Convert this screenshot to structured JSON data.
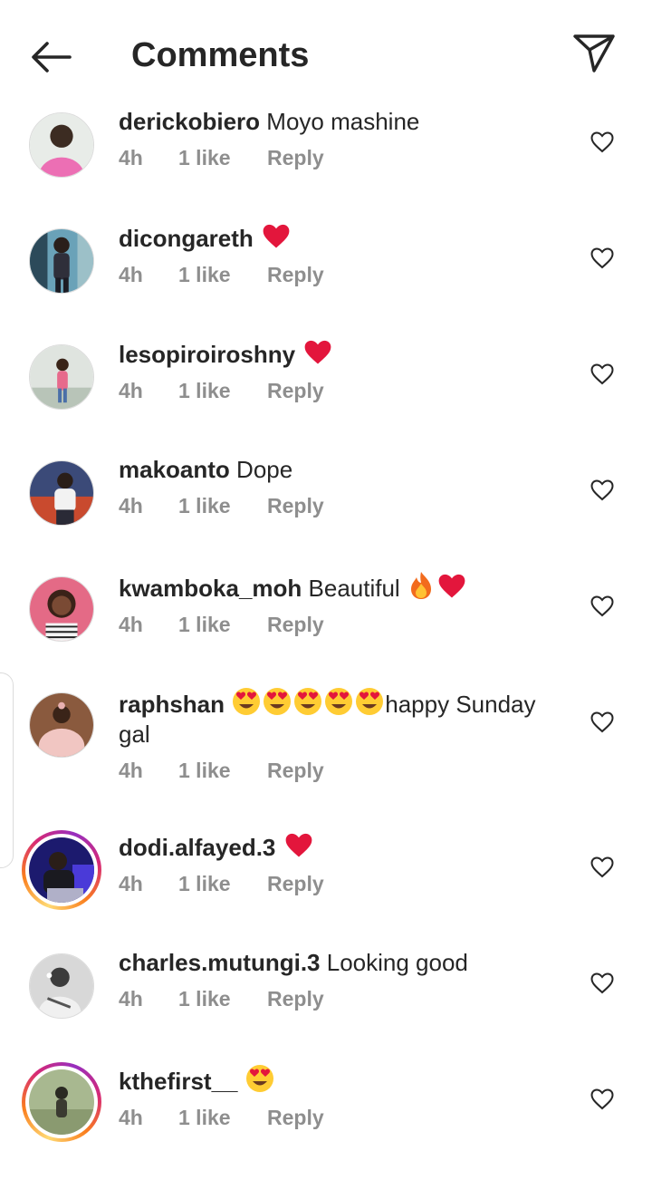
{
  "header": {
    "title": "Comments"
  },
  "comments": [
    {
      "username": "derickobiero",
      "text": "Moyo mashine",
      "emoji": [],
      "time": "4h",
      "likes": "1 like",
      "reply": "Reply"
    },
    {
      "username": "dicongareth",
      "text": "",
      "emoji": [
        "red-heart"
      ],
      "time": "4h",
      "likes": "1 like",
      "reply": "Reply"
    },
    {
      "username": "lesopiroiroshny",
      "text": "",
      "emoji": [
        "red-heart"
      ],
      "time": "4h",
      "likes": "1 like",
      "reply": "Reply"
    },
    {
      "username": "makoanto",
      "text": "Dope",
      "emoji": [],
      "time": "4h",
      "likes": "1 like",
      "reply": "Reply"
    },
    {
      "username": "kwamboka_moh",
      "text": "Beautiful",
      "emoji": [
        "fire",
        "red-heart"
      ],
      "time": "4h",
      "likes": "1 like",
      "reply": "Reply"
    },
    {
      "username": "raphshan",
      "text": "happy Sunday gal",
      "emoji": [
        "heart-eyes",
        "heart-eyes",
        "heart-eyes",
        "heart-eyes",
        "heart-eyes"
      ],
      "time": "4h",
      "likes": "1 like",
      "reply": "Reply"
    },
    {
      "username": "dodi.alfayed.3",
      "text": "",
      "emoji": [
        "red-heart"
      ],
      "time": "4h",
      "likes": "1 like",
      "reply": "Reply"
    },
    {
      "username": "charles.mutungi.3",
      "text": "Looking good",
      "emoji": [],
      "time": "4h",
      "likes": "1 like",
      "reply": "Reply"
    },
    {
      "username": "kthefirst__",
      "text": "",
      "emoji": [
        "heart-eyes"
      ],
      "time": "4h",
      "likes": "1 like",
      "reply": "Reply"
    }
  ],
  "colors": {
    "text": "#262626",
    "meta": "#8e8e8e",
    "heart": "#e3163c"
  },
  "icons": {
    "back": "back-arrow-icon",
    "send": "send-icon",
    "like": "heart-outline-icon"
  }
}
